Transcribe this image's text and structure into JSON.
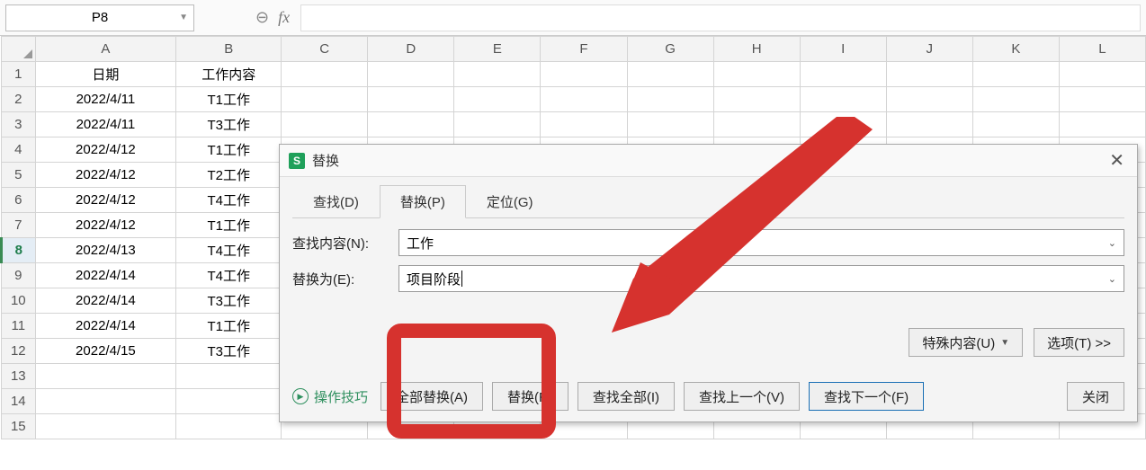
{
  "formula_bar": {
    "cell_ref": "P8",
    "fx_label": "fx",
    "formula_value": ""
  },
  "sheet": {
    "columns": [
      "A",
      "B",
      "C",
      "D",
      "E",
      "F",
      "G",
      "H",
      "I",
      "J",
      "K",
      "L"
    ],
    "active_row": 8,
    "rows": [
      {
        "n": 1,
        "a": "日期",
        "b": "工作内容"
      },
      {
        "n": 2,
        "a": "2022/4/11",
        "b": "T1工作"
      },
      {
        "n": 3,
        "a": "2022/4/11",
        "b": "T3工作"
      },
      {
        "n": 4,
        "a": "2022/4/12",
        "b": "T1工作"
      },
      {
        "n": 5,
        "a": "2022/4/12",
        "b": "T2工作"
      },
      {
        "n": 6,
        "a": "2022/4/12",
        "b": "T4工作"
      },
      {
        "n": 7,
        "a": "2022/4/12",
        "b": "T1工作"
      },
      {
        "n": 8,
        "a": "2022/4/13",
        "b": "T4工作"
      },
      {
        "n": 9,
        "a": "2022/4/14",
        "b": "T4工作"
      },
      {
        "n": 10,
        "a": "2022/4/14",
        "b": "T3工作"
      },
      {
        "n": 11,
        "a": "2022/4/14",
        "b": "T1工作"
      },
      {
        "n": 12,
        "a": "2022/4/15",
        "b": "T3工作"
      },
      {
        "n": 13,
        "a": "",
        "b": ""
      },
      {
        "n": 14,
        "a": "",
        "b": ""
      },
      {
        "n": 15,
        "a": "",
        "b": ""
      }
    ]
  },
  "dialog": {
    "title": "替换",
    "icon_letter": "S",
    "tabs": {
      "find": "查找(D)",
      "replace": "替换(P)",
      "goto": "定位(G)"
    },
    "active_tab": "replace",
    "find_label": "查找内容(N):",
    "find_value": "工作",
    "replace_label": "替换为(E):",
    "replace_value": "项目阶段",
    "special_btn": "特殊内容(U)",
    "options_btn": "选项(T) >>",
    "tips_label": "操作技巧",
    "replace_all_btn": "全部替换(A)",
    "replace_btn": "替换(R)",
    "find_all_btn": "查找全部(I)",
    "find_prev_btn": "查找上一个(V)",
    "find_next_btn": "查找下一个(F)",
    "close_btn": "关闭"
  }
}
